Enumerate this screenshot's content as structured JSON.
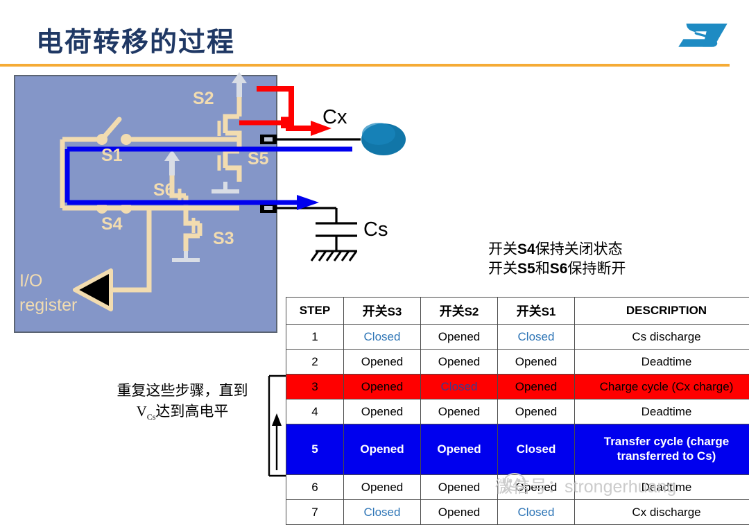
{
  "header": {
    "title": "电荷转移的过程",
    "logo_alt": "st-logo",
    "rule_color": "#f5ab35",
    "title_color": "#1f3864"
  },
  "circuit": {
    "panel_fill": "#8496c8",
    "wire_color": "#f2dcb0",
    "highlight_blue": "#0000ee",
    "highlight_red": "#ff0000",
    "labels": {
      "s1": "S1",
      "s2": "S2",
      "s3": "S3",
      "s4": "S4",
      "s5": "S5",
      "s6": "S6",
      "io_register_line1": "I/O",
      "io_register_line2": "register",
      "cx": "Cx",
      "cs": "Cs"
    }
  },
  "notes": {
    "right_line1_pre": "开关",
    "right_line1_sw": "S4",
    "right_line1_post": "保持关闭状态",
    "right_line2_pre": "开关",
    "right_line2_sw1": "S5",
    "right_line2_mid": "和",
    "right_line2_sw2": "S6",
    "right_line2_post": "保持断开",
    "left_line1": "重复这些步骤，直到",
    "left_line2_v": "V",
    "left_line2_sub": "Cs",
    "left_line2_rest": "达到高电平"
  },
  "table": {
    "headers": {
      "step": "STEP",
      "s3_pre": "开关",
      "s3_sw": "S3",
      "s2_pre": "开关",
      "s2_sw": "S2",
      "s1_pre": "开关",
      "s1_sw": "S1",
      "description": "DESCRIPTION"
    },
    "rows": [
      {
        "step": "1",
        "s3": "Closed",
        "s2": "Opened",
        "s1": "Closed",
        "desc": "Cs discharge",
        "style": "normal"
      },
      {
        "step": "2",
        "s3": "Opened",
        "s2": "Opened",
        "s1": "Opened",
        "desc": "Deadtime",
        "style": "normal"
      },
      {
        "step": "3",
        "s3": "Opened",
        "s2": "Closed",
        "s1": "Opened",
        "desc": "Charge cycle (Cx charge)",
        "style": "red"
      },
      {
        "step": "4",
        "s3": "Opened",
        "s2": "Opened",
        "s1": "Opened",
        "desc": "Deadtime",
        "style": "normal"
      },
      {
        "step": "5",
        "s3": "Opened",
        "s2": "Opened",
        "s1": "Closed",
        "desc": "Transfer cycle (charge transferred to Cs)",
        "style": "blue"
      },
      {
        "step": "6",
        "s3": "Opened",
        "s2": "Opened",
        "s1": "Opened",
        "desc": "Deadtime",
        "style": "normal"
      },
      {
        "step": "7",
        "s3": "Closed",
        "s2": "Opened",
        "s1": "Closed",
        "desc": "Cx discharge",
        "style": "normal"
      }
    ],
    "colors": {
      "closed_blue": "#2e75b6",
      "row_red": "#ff0000",
      "row_blue": "#0000ee"
    }
  },
  "watermark": {
    "text": "微信号：strongerhuang"
  }
}
